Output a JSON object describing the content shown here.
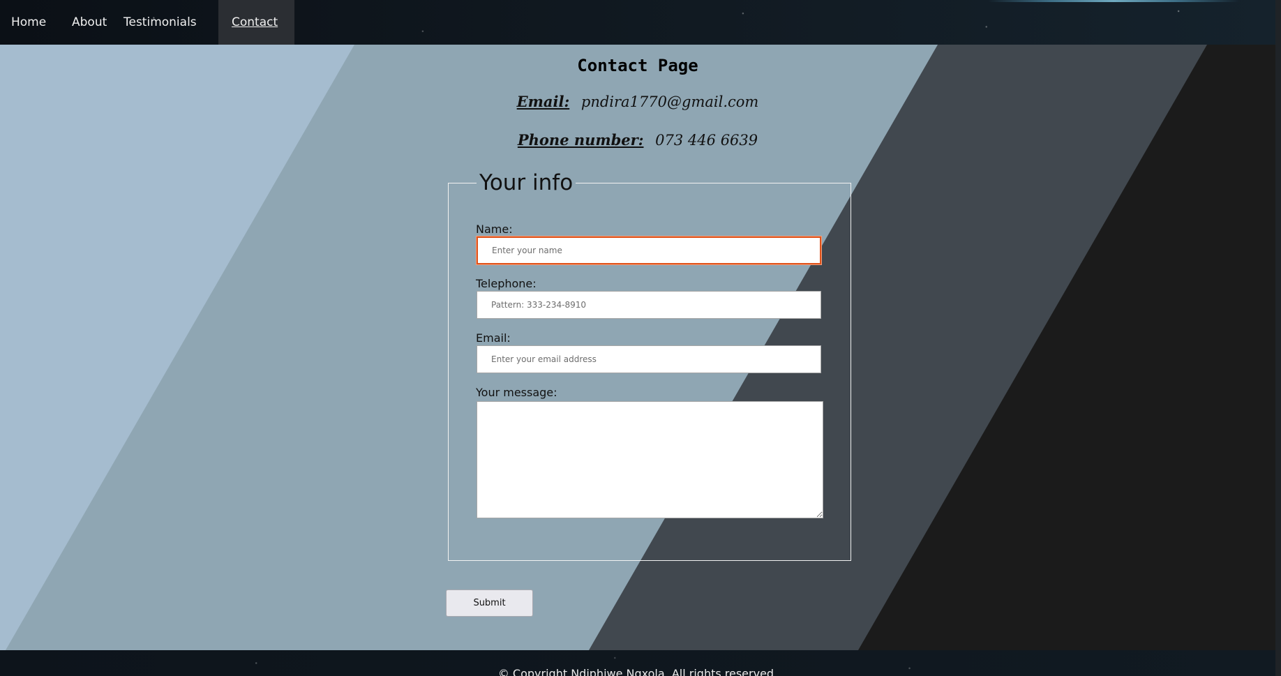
{
  "nav": {
    "items": [
      {
        "label": "Home"
      },
      {
        "label": "About"
      },
      {
        "label": "Testimonials"
      },
      {
        "label": "Contact",
        "active": true
      }
    ]
  },
  "header": {
    "title": "Contact Page",
    "email_label": "Email:",
    "email_value": "pndira1770@gmail.com",
    "phone_label": "Phone number:",
    "phone_value": "073 446 6639"
  },
  "form": {
    "legend": "Your info",
    "name": {
      "label": "Name:",
      "placeholder": "Enter your name",
      "value": ""
    },
    "telephone": {
      "label": "Telephone:",
      "placeholder": "Pattern: 333-234-8910",
      "value": ""
    },
    "email": {
      "label": "Email:",
      "placeholder": "Enter your email address",
      "value": ""
    },
    "message": {
      "label": "Your message:",
      "value": ""
    },
    "submit_label": "Submit"
  },
  "footer": {
    "text": "© Copyright Ndiphiwe Nqxola. All rights reserved."
  },
  "colors": {
    "band_light": "#a5bccf",
    "band_mid": "#8fa6b3",
    "band_dark": "#41484f",
    "band_black": "#1b1b1b",
    "focus_border": "#e0531b"
  }
}
